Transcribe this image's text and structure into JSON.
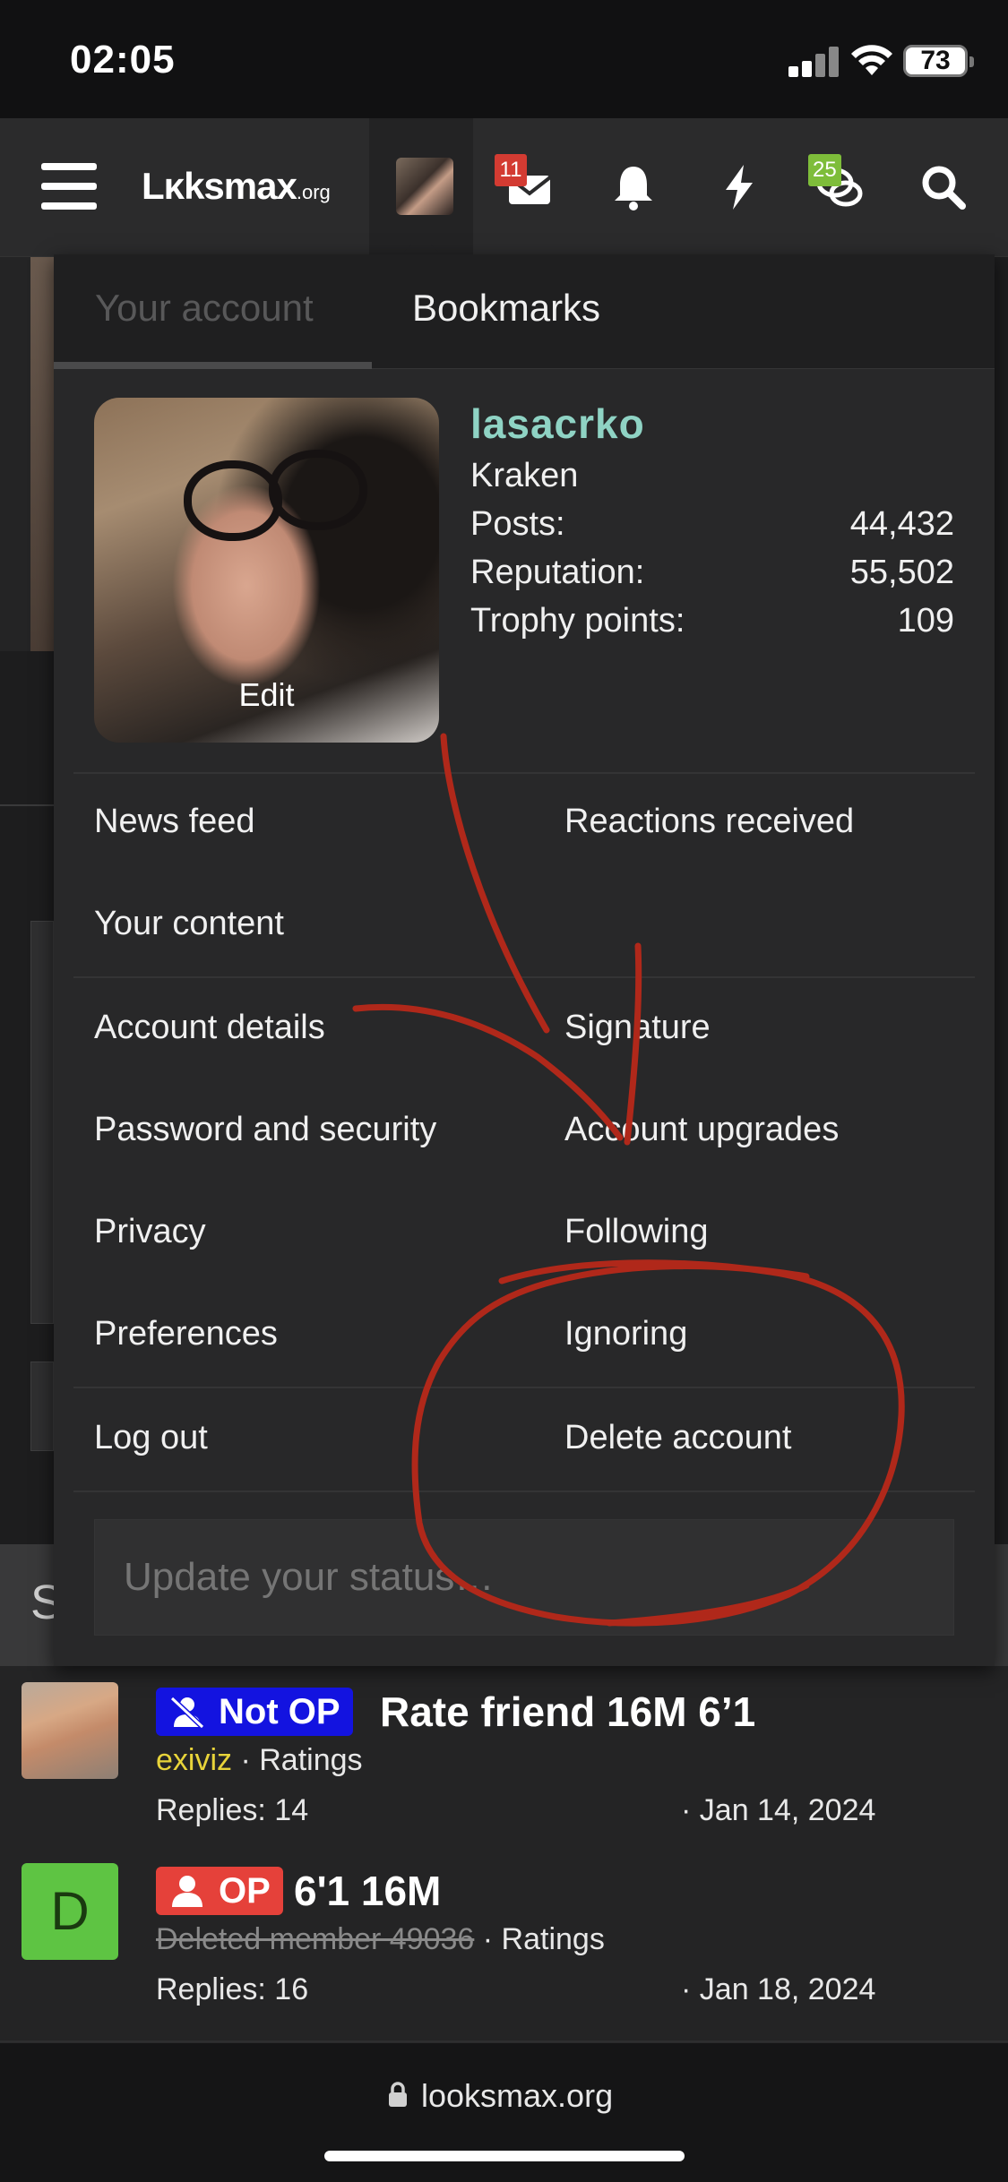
{
  "status_bar": {
    "time": "02:05",
    "battery": "73"
  },
  "nav": {
    "logo": "Lκksmax",
    "logo_suffix": ".org",
    "inbox_badge": "11",
    "conversations_badge": "25"
  },
  "dropdown": {
    "tabs": [
      {
        "label": "Your account"
      },
      {
        "label": "Bookmarks"
      }
    ],
    "profile": {
      "photo_action": "Edit",
      "username": "lasacrko",
      "user_title": "Kraken",
      "stats": [
        {
          "label": "Posts:",
          "value": "44,432"
        },
        {
          "label": "Reputation:",
          "value": "55,502"
        },
        {
          "label": "Trophy points:",
          "value": "109"
        }
      ]
    },
    "menu_left": [
      "News feed",
      "Your content",
      "Account details",
      "Password and security",
      "Privacy",
      "Preferences",
      "Log out"
    ],
    "menu_right": [
      "Reactions received",
      "Signature",
      "Account upgrades",
      "Following",
      "Ignoring",
      "Delete account"
    ],
    "status_placeholder": "Update your status…"
  },
  "threads": [
    {
      "prefix": "Not OP",
      "prefix_color": "#1313e0",
      "title": "Rate friend 16M 6’1",
      "author": "exiviz",
      "forum": "Ratings",
      "replies": "Replies: 14",
      "date": "Jan 14, 2024"
    },
    {
      "avatar_letter": "D",
      "avatar_color": "#5ec443",
      "prefix": "OP",
      "prefix_color": "#e5413a",
      "title": "6'1 16M",
      "author": "Deleted member 49036",
      "forum": "Ratings",
      "replies": "Replies: 16",
      "date": "Jan 18, 2024"
    }
  ],
  "background_section_letter": "S",
  "url_bar": {
    "domain": "looksmax.org"
  },
  "colors": {
    "username": "#8fd3c4",
    "annotation": "#b0281a",
    "author_highlight": "#e8d43a"
  }
}
